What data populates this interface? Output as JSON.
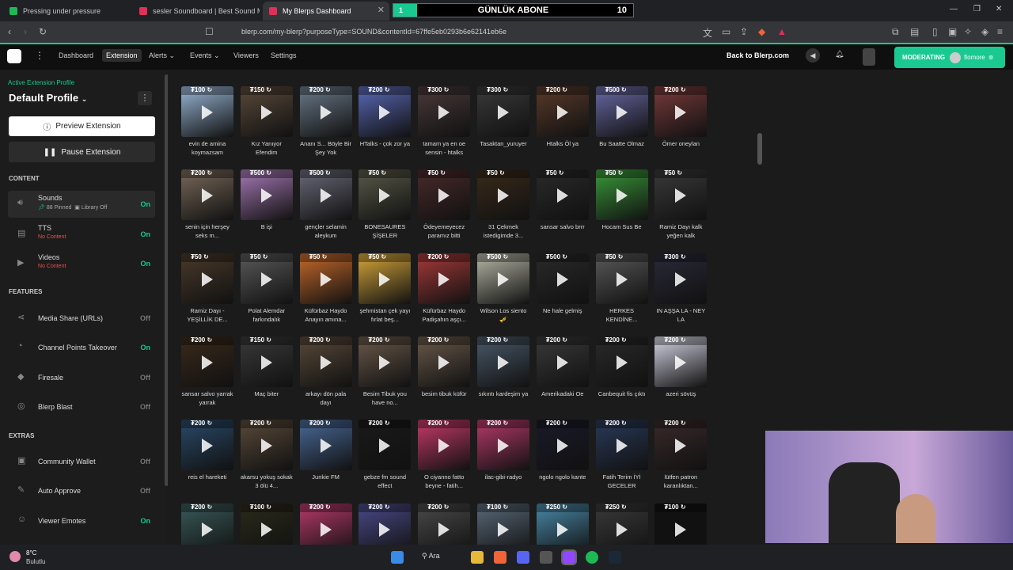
{
  "tabs": [
    {
      "label": "Pressing under pressure",
      "color": "#1db954"
    },
    {
      "label": "sesler Soundboard | Best Sound Mem...",
      "color": "#e03058"
    },
    {
      "label": "My Blerps Dashboard",
      "color": "#e03058"
    }
  ],
  "overlay": {
    "progress": "1",
    "title": "GÜNLÜK ABONE",
    "goal": "10",
    "fill_fraction": 0.1
  },
  "address": {
    "url": "blerp.com/my-blerp?purposeType=SOUND&contentId=67ffe5eb0293b6e62141eb6e"
  },
  "nav": {
    "items": [
      "Dashboard",
      "Extension",
      "Alerts",
      "Events",
      "Viewers",
      "Settings"
    ],
    "selected": "Extension",
    "back": "Back to Blerp.com",
    "moderating": "MODERATING",
    "user": "flomore"
  },
  "sidebar": {
    "profile_label": "Active Extension Profile",
    "profile": "Default Profile",
    "preview": "Preview Extension",
    "pause": "Pause Extension",
    "content_h": "CONTENT",
    "features_h": "FEATURES",
    "extras_h": "EXTRAS",
    "content": [
      {
        "name": "Sounds",
        "sub1": "88 Pinned",
        "sub2": "Library Off",
        "status": "On"
      },
      {
        "name": "TTS",
        "sub": "No Content",
        "status": "On"
      },
      {
        "name": "Videos",
        "sub": "No Content",
        "status": "On"
      }
    ],
    "features": [
      {
        "name": "Media Share (URLs)",
        "status": "Off"
      },
      {
        "name": "Channel Points Takeover",
        "status": "On"
      },
      {
        "name": "Firesale",
        "status": "Off"
      },
      {
        "name": "Blerp Blast",
        "status": "Off"
      }
    ],
    "extras": [
      {
        "name": "Community Wallet",
        "status": "Off"
      },
      {
        "name": "Auto Approve",
        "status": "Off"
      },
      {
        "name": "Viewer Emotes",
        "status": "On"
      }
    ]
  },
  "sounds": [
    {
      "price": "100",
      "title": "evin de amina koymazsam",
      "color": "#9ab8d8"
    },
    {
      "price": "150",
      "title": "Kız Yanıyor Efendim",
      "color": "#5a4a3a"
    },
    {
      "price": "200",
      "title": "Ananı S... Böyle Bir Şey Yok",
      "color": "#6a7a8a"
    },
    {
      "price": "200",
      "title": "HTalks - çok zor ya",
      "color": "#5a6ab8"
    },
    {
      "price": "300",
      "title": "tamam ya en oe sensin - htalks",
      "color": "#4a3a3a"
    },
    {
      "price": "300",
      "title": "Tasaktan_yuruyer",
      "color": "#3a3a3a"
    },
    {
      "price": "200",
      "title": "Htalks Öl ya",
      "color": "#5a3a2a"
    },
    {
      "price": "500",
      "title": "Bu Saatte Olmaz",
      "color": "#6a6aa8"
    },
    {
      "price": "200",
      "title": "Ömer oneylan",
      "color": "#7a3a3a"
    },
    {
      "price": "200",
      "title": "senin için herşey seks m...",
      "color": "#7a6a5a"
    },
    {
      "price": "500",
      "title": "B işi",
      "color": "#a87ab8"
    },
    {
      "price": "500",
      "title": "gençler selamin aleykum",
      "color": "#6a6a7a"
    },
    {
      "price": "50",
      "title": "BONESAURES ŞİŞELER",
      "color": "#5a5a4a"
    },
    {
      "price": "50",
      "title": "Ödeyemeyecez paramız bitti",
      "color": "#4a2a2a"
    },
    {
      "price": "50",
      "title": "31 Çekmek istedigimde 3...",
      "color": "#3a2a1a"
    },
    {
      "price": "50",
      "title": "sansar salvo brrr",
      "color": "#2a2a2a"
    },
    {
      "price": "50",
      "title": "Hocam Sus Be",
      "color": "#3a9a3a"
    },
    {
      "price": "50",
      "title": "Ramiz Dayı kalk yeğen kalk",
      "color": "#3a3a3a"
    },
    {
      "price": "50",
      "title": "Ramiz Dayı - YEŞİLLİK DE...",
      "color": "#4a3a2a"
    },
    {
      "price": "50",
      "title": "Polat Alemdar farkındalık",
      "color": "#5a5a5a"
    },
    {
      "price": "50",
      "title": "Küfürbaz Haydo Anayın amına...",
      "color": "#c86a2a"
    },
    {
      "price": "50",
      "title": "şehmistan çek yayı fırlat beş...",
      "color": "#d8a83a"
    },
    {
      "price": "200",
      "title": "Küfürbaz Haydo Padişahın aşçı...",
      "color": "#a83a3a"
    },
    {
      "price": "500",
      "title": "Wilson Los siento 🎺",
      "color": "#b8b8a8"
    },
    {
      "price": "500",
      "title": "Ne hale gelmiş",
      "color": "#2a2a2a"
    },
    {
      "price": "50",
      "title": "HERKES KENDİNE...",
      "color": "#5a5a5a"
    },
    {
      "price": "300",
      "title": "IN AŞŞA LA - NEY LA",
      "color": "#2a2a3a"
    },
    {
      "price": "200",
      "title": "sansar salvo yarrak yarrak",
      "color": "#3a2a1a"
    },
    {
      "price": "150",
      "title": "Maç biter",
      "color": "#3a3a3a"
    },
    {
      "price": "200",
      "title": "arkayı dön pala dayı",
      "color": "#5a4a3a"
    },
    {
      "price": "200",
      "title": "Besim Tibuk you have no...",
      "color": "#6a5a4a"
    },
    {
      "price": "200",
      "title": "besim tibuk küfür",
      "color": "#6a5a4a"
    },
    {
      "price": "200",
      "title": "sıkıntı kardeşim ya",
      "color": "#4a5a6a"
    },
    {
      "price": "200",
      "title": "Amerikadaki Oe",
      "color": "#3a3a3a"
    },
    {
      "price": "200",
      "title": "Canbequit fis çıktı",
      "color": "#2a2a2a"
    },
    {
      "price": "200",
      "title": "azeri sövüş",
      "color": "#d8d8e8"
    },
    {
      "price": "200",
      "title": "reis el hareketi",
      "color": "#2a4a6a"
    },
    {
      "price": "200",
      "title": "akarsu yokuş sokak 3 ölü 4...",
      "color": "#5a4a3a"
    },
    {
      "price": "200",
      "title": "Junkie FM",
      "color": "#4a6a9a"
    },
    {
      "price": "200",
      "title": "gebze fm sound effect",
      "color": "#1a1a1a"
    },
    {
      "price": "200",
      "title": "O ciyanno fatto beyne - fatih...",
      "color": "#c83a6a"
    },
    {
      "price": "200",
      "title": "ilac-gibi-radyo",
      "color": "#b83a6a"
    },
    {
      "price": "200",
      "title": "ngolo ngolo kante",
      "color": "#1a1a2a"
    },
    {
      "price": "200",
      "title": "Fatih Terim İYİ GECELER",
      "color": "#2a3a5a"
    },
    {
      "price": "200",
      "title": "lütfen patron karanlıktan...",
      "color": "#3a2a2a"
    },
    {
      "price": "200",
      "title": "",
      "color": "#3a5a5a"
    },
    {
      "price": "100",
      "title": "",
      "color": "#2a2a1a"
    },
    {
      "price": "200",
      "title": "",
      "color": "#b83a6a"
    },
    {
      "price": "200",
      "title": "",
      "color": "#4a4a8a"
    },
    {
      "price": "200",
      "title": "",
      "color": "#4a4a4a"
    },
    {
      "price": "100",
      "title": "",
      "color": "#5a6a7a"
    },
    {
      "price": "250",
      "title": "",
      "color": "#4a8aaa"
    },
    {
      "price": "250",
      "title": "",
      "color": "#3a3a3a"
    },
    {
      "price": "100",
      "title": "SAMSUNG",
      "color": "#111111"
    }
  ],
  "taskbar": {
    "temp": "8°C",
    "weather": "Bulutlu",
    "search": "Ara"
  }
}
